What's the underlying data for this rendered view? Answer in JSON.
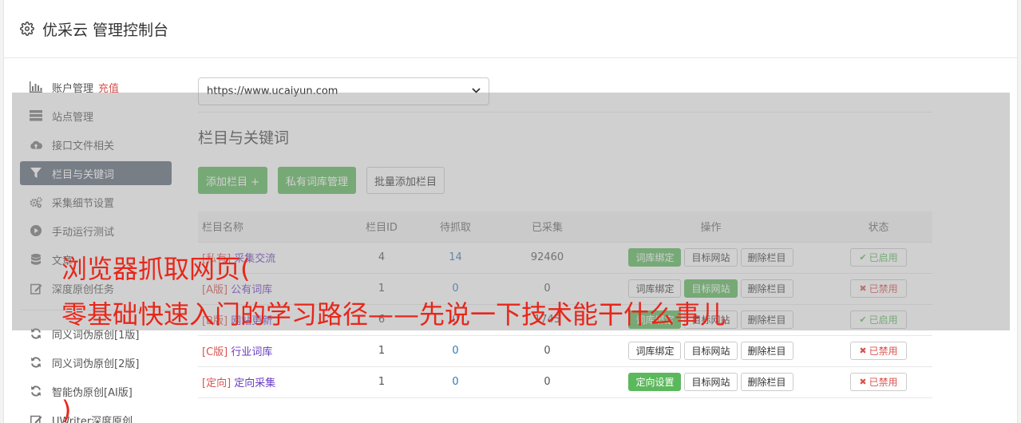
{
  "header": {
    "title": "优采云 管理控制台",
    "icon": "gear-icon"
  },
  "sidebar": {
    "items": [
      {
        "label": "账户管理",
        "extra": "充值",
        "icon": "bar-chart-icon"
      },
      {
        "label": "站点管理",
        "icon": "server-icon"
      },
      {
        "label": "接口文件相关",
        "icon": "cloud-upload-icon"
      },
      {
        "label": "栏目与关键词",
        "icon": "filter-icon",
        "active": true
      },
      {
        "label": "采集细节设置",
        "icon": "gears-icon"
      },
      {
        "label": "手动运行测试",
        "icon": "play-icon"
      },
      {
        "label": "文章",
        "icon": "database-icon"
      },
      {
        "label": "深度原创任务",
        "icon": "edit-icon"
      },
      {
        "label": "同义词伪原创[1版]",
        "icon": "refresh-icon"
      },
      {
        "label": "同义词伪原创[2版]",
        "icon": "refresh-icon"
      },
      {
        "label": "智能伪原创[AI版]",
        "icon": "refresh-icon"
      },
      {
        "label": "UWriter深度原创",
        "icon": "edit-icon"
      }
    ]
  },
  "main": {
    "site_select": {
      "value": "https://www.ucaiyun.com"
    },
    "section_title": "栏目与关键词",
    "buttons": {
      "add": "添加栏目 +",
      "private_lib": "私有词库管理",
      "batch_add": "批量添加栏目"
    },
    "table": {
      "headers": [
        "栏目名称",
        "栏目ID",
        "待抓取",
        "已采集",
        "操作",
        "状态"
      ],
      "rows": [
        {
          "type": "[私有]",
          "name": "采集交流",
          "id": "4",
          "pending": "14",
          "collected": "92460",
          "ops": [
            {
              "label": "词库绑定",
              "green": true
            },
            {
              "label": "目标网站",
              "green": false
            },
            {
              "label": "删除栏目",
              "green": false
            }
          ],
          "status": "已启用",
          "status_on": true
        },
        {
          "type": "[A版]",
          "name": "公有词库",
          "id": "1",
          "pending": "0",
          "collected": "0",
          "ops": [
            {
              "label": "词库绑定",
              "green": false
            },
            {
              "label": "目标网站",
              "green": true
            },
            {
              "label": "删除栏目",
              "green": false
            }
          ],
          "status": "已禁用",
          "status_on": false
        },
        {
          "type": "[B版]",
          "name": "网站更新",
          "id": "6",
          "pending": "0",
          "collected": "1745",
          "ops": [
            {
              "label": "词库绑定",
              "green": true
            },
            {
              "label": "目标网站",
              "green": false
            },
            {
              "label": "删除栏目",
              "green": false
            }
          ],
          "status": "已启用",
          "status_on": true
        },
        {
          "type": "[C版]",
          "name": "行业词库",
          "id": "1",
          "pending": "0",
          "collected": "0",
          "ops": [
            {
              "label": "词库绑定",
              "green": false
            },
            {
              "label": "目标网站",
              "green": false
            },
            {
              "label": "删除栏目",
              "green": false
            }
          ],
          "status": "已禁用",
          "status_on": false
        },
        {
          "type": "[定向]",
          "name": "定向采集",
          "id": "1",
          "pending": "0",
          "collected": "0",
          "ops": [
            {
              "label": "定向设置",
              "green": true
            },
            {
              "label": "目标网站",
              "green": false
            },
            {
              "label": "删除栏目",
              "green": false
            }
          ],
          "status": "已禁用",
          "status_on": false
        }
      ]
    }
  },
  "overlay_text": {
    "line1": "浏览器抓取网页(",
    "line2": "零基础快速入门的学习路径——先说一下技术能干什么事儿",
    "line3": ")"
  },
  "colors": {
    "green": "#5cb85c",
    "red": "#d9534f",
    "active_nav": "#5f6b79",
    "overlay_text": "#e8261a"
  }
}
